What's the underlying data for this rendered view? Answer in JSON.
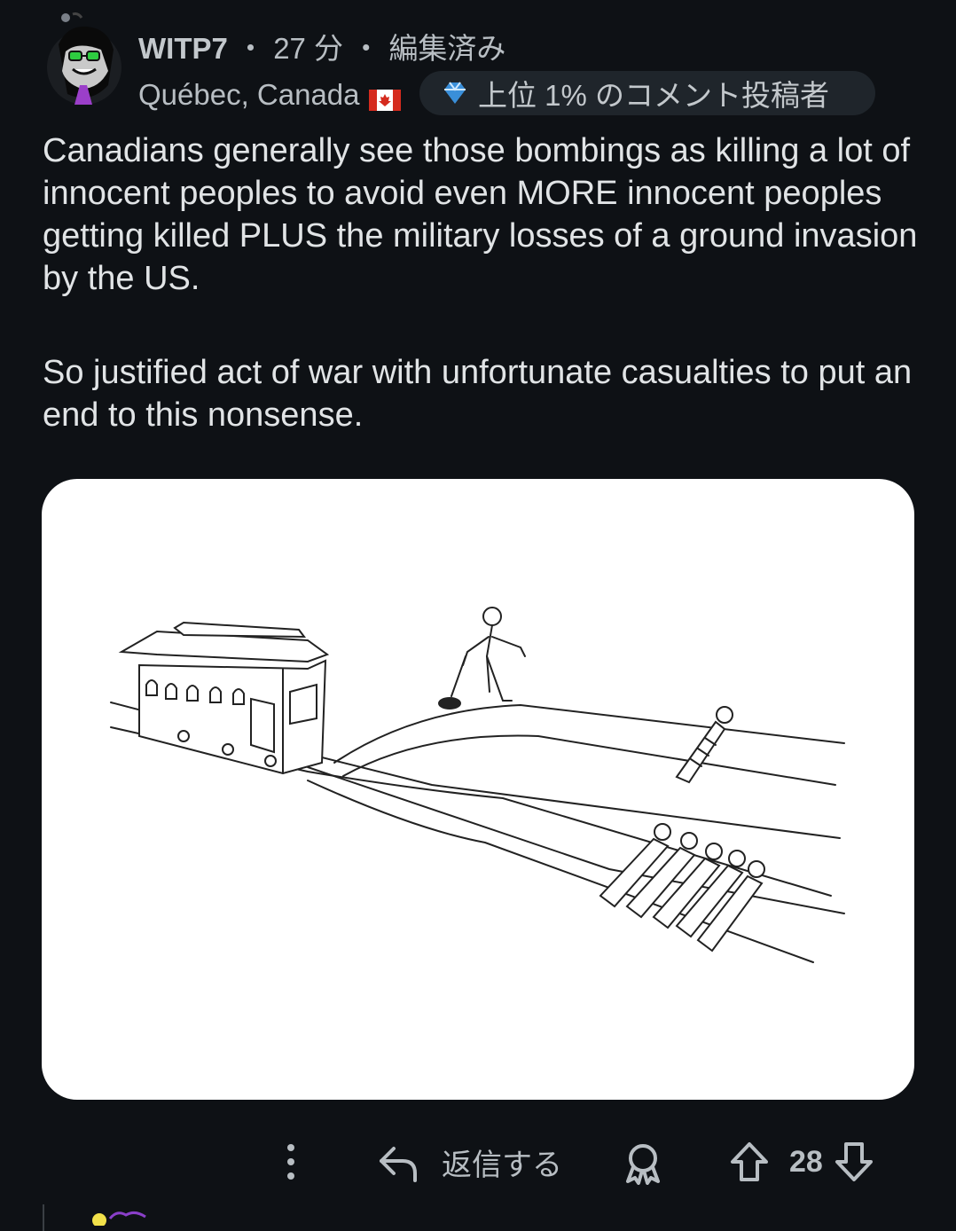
{
  "comment": {
    "username": "WITP7",
    "time": "27 分",
    "edited": "編集済み",
    "location": "Québec, Canada",
    "flag_icon": "canada-flag-icon",
    "badge_label": "上位 1% のコメント投稿者",
    "paragraphs": [
      "Canadians generally see those bombings as killing a lot of innocent peoples to avoid even MORE innocent peoples getting killed PLUS the military losses of a ground invasion by the US.",
      "So justified act of war with unfortunate casualties to put an end to this nonsense."
    ],
    "image_description_icon": "trolley-problem-drawing"
  },
  "actions": {
    "reply_label": "返信する",
    "vote_count": "28"
  },
  "colors": {
    "background": "#0e1115",
    "text": "#e1e4e6",
    "muted": "#b8bec3",
    "badge_bg": "#1f252b"
  }
}
